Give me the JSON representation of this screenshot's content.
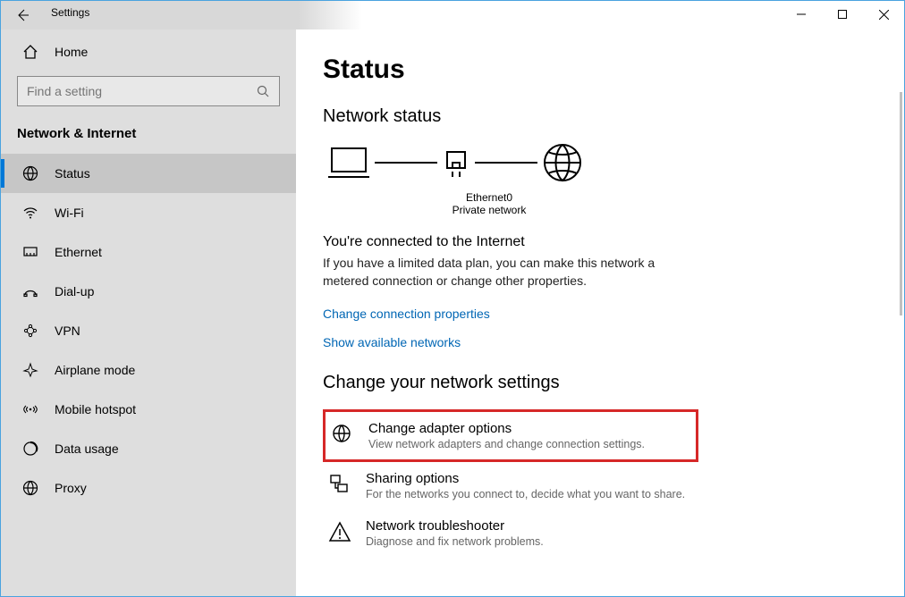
{
  "window": {
    "title": "Settings"
  },
  "sidebar": {
    "home_label": "Home",
    "search_placeholder": "Find a setting",
    "section_title": "Network & Internet",
    "items": [
      {
        "label": "Status"
      },
      {
        "label": "Wi-Fi"
      },
      {
        "label": "Ethernet"
      },
      {
        "label": "Dial-up"
      },
      {
        "label": "VPN"
      },
      {
        "label": "Airplane mode"
      },
      {
        "label": "Mobile hotspot"
      },
      {
        "label": "Data usage"
      },
      {
        "label": "Proxy"
      }
    ]
  },
  "main": {
    "page_title": "Status",
    "status_heading": "Network status",
    "diagram": {
      "adapter_name": "Ethernet0",
      "network_type": "Private network"
    },
    "connected_heading": "You're connected to the Internet",
    "connected_body": "If you have a limited data plan, you can make this network a metered connection or change other properties.",
    "link_change_props": "Change connection properties",
    "link_show_nets": "Show available networks",
    "change_settings_heading": "Change your network settings",
    "options": [
      {
        "title": "Change adapter options",
        "desc": "View network adapters and change connection settings."
      },
      {
        "title": "Sharing options",
        "desc": "For the networks you connect to, decide what you want to share."
      },
      {
        "title": "Network troubleshooter",
        "desc": "Diagnose and fix network problems."
      }
    ]
  }
}
